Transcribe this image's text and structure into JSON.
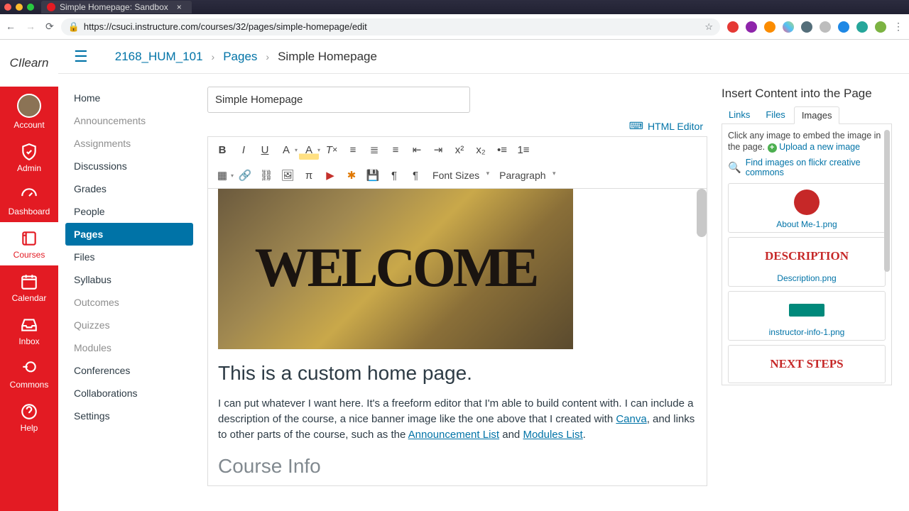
{
  "browser": {
    "tab_title": "Simple Homepage: Sandbox",
    "url": "https://csuci.instructure.com/courses/32/pages/simple-homepage/edit"
  },
  "brand": {
    "a": "CI",
    "b": " learn"
  },
  "global_nav": [
    {
      "label": "Account"
    },
    {
      "label": "Admin"
    },
    {
      "label": "Dashboard"
    },
    {
      "label": "Courses"
    },
    {
      "label": "Calendar"
    },
    {
      "label": "Inbox"
    },
    {
      "label": "Commons"
    },
    {
      "label": "Help"
    }
  ],
  "breadcrumbs": {
    "course": "2168_HUM_101",
    "section": "Pages",
    "current": "Simple Homepage"
  },
  "course_nav": [
    {
      "label": "Home",
      "style": "dark"
    },
    {
      "label": "Announcements",
      "style": "muted"
    },
    {
      "label": "Assignments",
      "style": "muted"
    },
    {
      "label": "Discussions",
      "style": "dark"
    },
    {
      "label": "Grades",
      "style": "dark"
    },
    {
      "label": "People",
      "style": "dark"
    },
    {
      "label": "Pages",
      "style": "active"
    },
    {
      "label": "Files",
      "style": "dark"
    },
    {
      "label": "Syllabus",
      "style": "dark"
    },
    {
      "label": "Outcomes",
      "style": "muted"
    },
    {
      "label": "Quizzes",
      "style": "muted"
    },
    {
      "label": "Modules",
      "style": "muted"
    },
    {
      "label": "Conferences",
      "style": "dark"
    },
    {
      "label": "Collaborations",
      "style": "dark"
    },
    {
      "label": "Settings",
      "style": "dark"
    }
  ],
  "editor": {
    "title_value": "Simple Homepage",
    "html_editor_label": "HTML Editor",
    "font_sizes_label": "Font Sizes",
    "paragraph_label": "Paragraph",
    "welcome_word": "WELCOME",
    "heading": "This is a custom home page.",
    "para_a": "I can put whatever I want here. It's a freeform editor that I'm able to build content with. I can include a description of the course, a nice banner image like the one above that I created with ",
    "link_canva": "Canva",
    "para_b": ", and links to other parts of the course, such as the ",
    "link_ann": "Announcement List",
    "para_c": " and ",
    "link_mod": "Modules List",
    "para_d": ".",
    "heading2": "Course Info"
  },
  "insert": {
    "heading": "Insert Content into the Page",
    "tabs": {
      "links": "Links",
      "files": "Files",
      "images": "Images"
    },
    "help_a": "Click any image to embed the image in the page.",
    "upload": "Upload a new image",
    "find": "Find images on flickr creative commons",
    "thumbs": [
      {
        "label": "About Me-1.png",
        "text": "",
        "color": "#c62828",
        "circle": true
      },
      {
        "label": "Description.png",
        "text": "DESCRIPTION",
        "color": "#c62828"
      },
      {
        "label": "instructor-info-1.png",
        "text": "",
        "color": "#00897b",
        "badge": true
      },
      {
        "label": "",
        "text": "NEXT STEPS",
        "color": "#c62828"
      }
    ]
  }
}
